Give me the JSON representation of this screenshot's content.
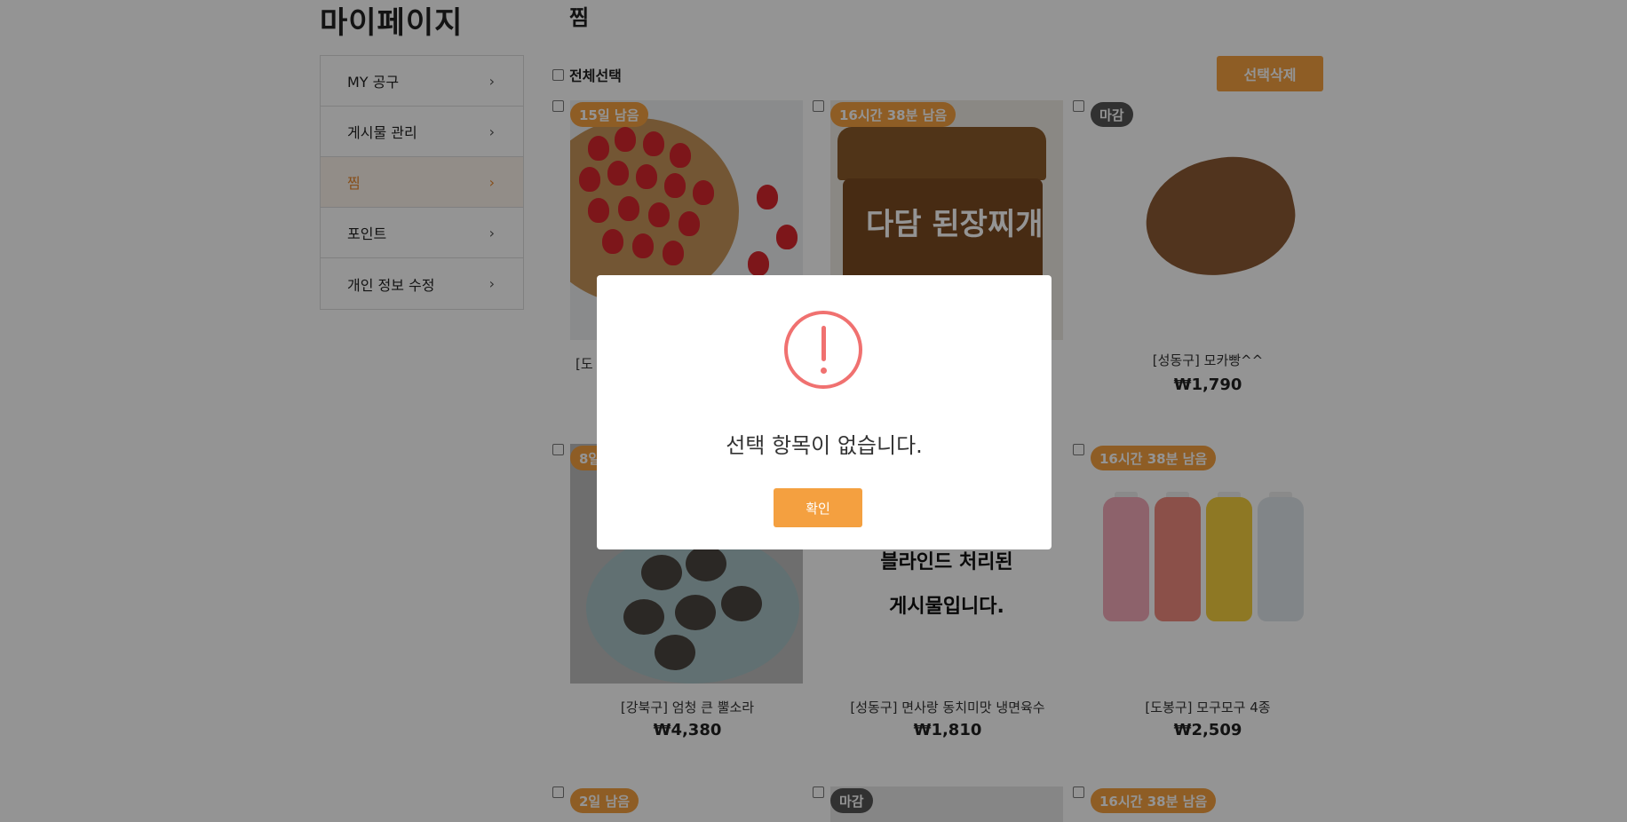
{
  "header": {
    "mypage_title": "마이페이지",
    "section_title": "찜"
  },
  "sidebar": {
    "items": [
      {
        "label": "MY 공구",
        "active": false
      },
      {
        "label": "게시물 관리",
        "active": false
      },
      {
        "label": "찜",
        "active": true
      },
      {
        "label": "포인트",
        "active": false
      },
      {
        "label": "개인 정보 수정",
        "active": false
      }
    ]
  },
  "toolbar": {
    "select_all_label": "전체선택",
    "delete_label": "선택삭제"
  },
  "products": [
    {
      "badge": "15일 남음",
      "badge_color": "orange",
      "name": "[도",
      "price": ""
    },
    {
      "badge": "16시간 38분 남음",
      "badge_color": "orange",
      "name": "",
      "price": "",
      "label": "다담 된장찌개"
    },
    {
      "badge": "마감",
      "badge_color": "gray",
      "name": "[성동구] 모카빵^^",
      "price": "₩1,790"
    },
    {
      "badge": "8일",
      "badge_color": "orange",
      "name": "[강북구] 엄청 큰 뿔소라",
      "price": "₩4,380"
    },
    {
      "badge": "",
      "badge_color": "orange",
      "name": "[성동구] 면사랑 동치미맛 냉면육수",
      "price": "₩1,810",
      "blind_line1": "블라인드 처리된",
      "blind_line2": "게시물입니다."
    },
    {
      "badge": "16시간 38분 남음",
      "badge_color": "orange",
      "name": "[도봉구] 모구모구 4종",
      "price": "₩2,509"
    },
    {
      "badge": "2일 남음",
      "badge_color": "orange",
      "name": "",
      "price": ""
    },
    {
      "badge": "마감",
      "badge_color": "gray",
      "name": "",
      "price": ""
    },
    {
      "badge": "16시간 38분 남음",
      "badge_color": "orange",
      "name": "",
      "price": ""
    }
  ],
  "modal": {
    "message": "선택 항목이 없습니다.",
    "confirm_label": "확인"
  },
  "colors": {
    "accent": "#f4a040",
    "alert": "#f07170",
    "badge_closed": "#555555"
  }
}
